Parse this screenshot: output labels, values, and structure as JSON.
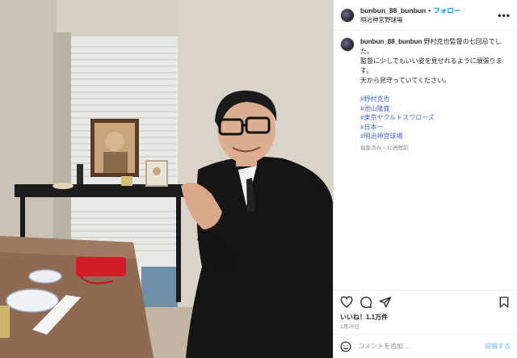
{
  "header": {
    "username": "bunbun_88_bunbun",
    "separator": "•",
    "follow_label": "フォロー",
    "location": "明治神宮野球場",
    "more_icon": "more-horizontal-icon"
  },
  "caption": {
    "username": "bunbun_88_bunbun",
    "text": "野村克也監督の七回忌でした。\n監督に少しでもいい姿を見せれるように頑張ります。\n天から見守っていてください。",
    "hashtags": [
      "#野村克也",
      "#池山隆寛",
      "#東京ヤクルトスワローズ",
      "#日本一",
      "#明治神宮球場"
    ],
    "meta": "編集済み・12週間前"
  },
  "actions": {
    "like_icon": "heart-icon",
    "comment_icon": "comment-icon",
    "share_icon": "send-icon",
    "save_icon": "bookmark-icon"
  },
  "likes_text": "いいね！1.1万件",
  "date_text": "1月28日",
  "comment_box": {
    "emoji_icon": "emoji-icon",
    "placeholder": "コメントを追加...",
    "post_label": "投稿する"
  },
  "colors": {
    "link": "#0095f6",
    "hashtag": "#3f6ad8",
    "muted": "#8e8e8e"
  }
}
